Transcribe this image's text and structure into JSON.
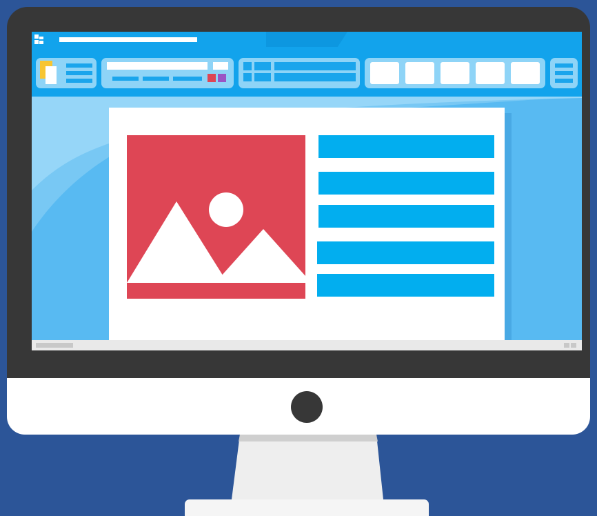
{
  "illustration": {
    "subject": "desktop-monitor-with-document-editor",
    "colors": {
      "background": "#2c5598",
      "bezel": "#373737",
      "screen": "#58baf2",
      "ribbon": "#12a3ec",
      "ribbon_group": "#8ed4f7",
      "image_placeholder": "#de4655",
      "text_line": "#02aeef",
      "page": "#ffffff"
    },
    "icons": [
      "app-logo-icon",
      "image-placeholder-icon",
      "sun-icon",
      "mountain-icon",
      "power-button-icon"
    ]
  }
}
